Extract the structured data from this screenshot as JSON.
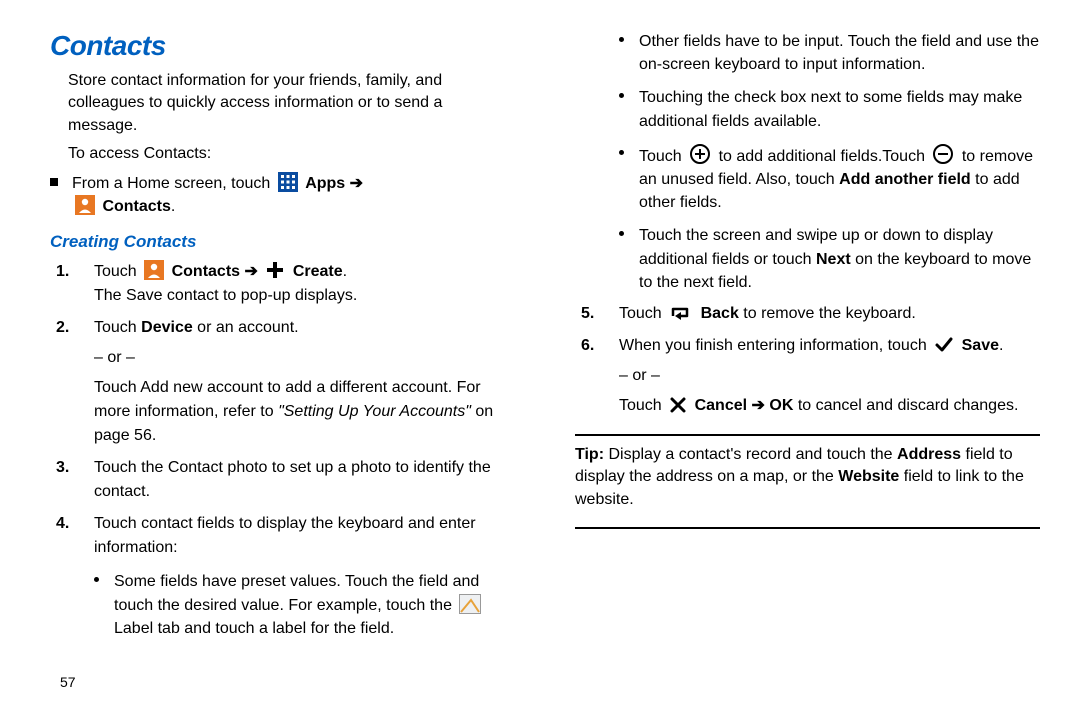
{
  "h1": "Contacts",
  "intro": "Store contact information for your friends, family, and colleagues to quickly access information or to send a message.",
  "access_lead": "To access Contacts:",
  "access_step_pre": "From a Home screen, touch ",
  "apps_label": "Apps",
  "contacts_label": "Contacts",
  "h2": "Creating Contacts",
  "s1_pre": "Touch ",
  "create_label": "Create",
  "s1_post": "The Save contact to pop-up displays.",
  "s2_a": "Touch ",
  "device_label": "Device",
  "s2_b": " or an account.",
  "or": "– or –",
  "s2_c": "Touch Add new account to add a different account. For more information, refer to ",
  "refer_quote": "\"Setting Up Your Accounts\"",
  "s2_d": "on page 56.",
  "s3": "Touch the Contact photo to set up a photo to identify the contact.",
  "s4": "Touch contact fields to display the keyboard and enter information:",
  "sub_a_1": "Some fields have preset values. Touch the field and touch the desired value. For example, touch the ",
  "sub_a_2": " Label tab and touch a label for the field.",
  "sub_b": "Other fields have to be input. Touch the field and use the on-screen keyboard to input information.",
  "sub_c": "Touching the check box next to some fields may make additional fields available.",
  "sub_d_1": "Touch ",
  "sub_d_2": " to add additional fields.Touch ",
  "sub_d_3": " to remove an unused field. Also, touch ",
  "add_another": "Add another field",
  "sub_d_4": " to add other fields.",
  "sub_e_1": "Touch the screen and swipe up or down to display additional fields or touch ",
  "next_label": "Next",
  "sub_e_2": " on the keyboard to move to the next field.",
  "s5_pre": "Touch ",
  "back_label": "Back",
  "s5_post": " to remove the keyboard.",
  "s6_pre": "When you finish entering information, touch ",
  "save_label": "Save",
  "s6_x_pre": "Touch ",
  "cancel_label": "Cancel",
  "ok_label": "OK",
  "s6_x_post": " to cancel and discard changes.",
  "tip_label": "Tip:",
  "tip_1": " Display a contact's record and touch the ",
  "address_label": "Address",
  "tip_2": " field to display the address on a map, or the ",
  "website_label": "Website",
  "tip_3": " field to link to the website.",
  "pagenum": "57"
}
